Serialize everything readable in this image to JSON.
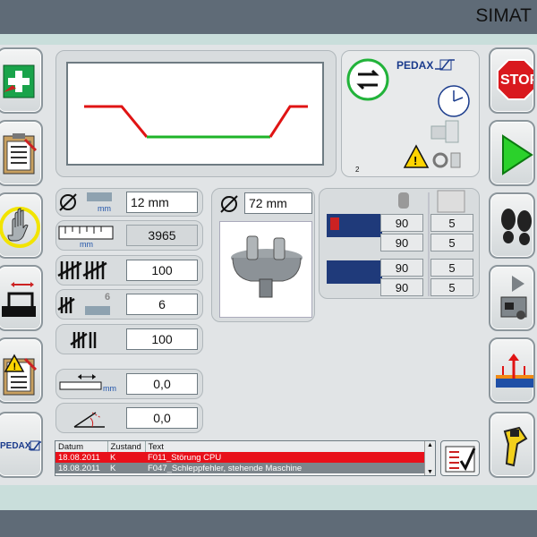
{
  "header": {
    "brand": "SIMAT"
  },
  "left_buttons": [
    {
      "name": "first-aid-button",
      "icon": "first-aid-icon"
    },
    {
      "name": "clipboard-button",
      "icon": "clipboard-icon"
    },
    {
      "name": "manual-hand-button",
      "icon": "hand-icon"
    },
    {
      "name": "bend-setup-button",
      "icon": "bend-machine-icon"
    },
    {
      "name": "warning-checklist-button",
      "icon": "warning-checklist-icon"
    },
    {
      "name": "pedax-logo-button",
      "icon": "pedax-logo-icon"
    }
  ],
  "right_buttons": [
    {
      "name": "stop-button",
      "label": "STOP",
      "icon": "stop-sign-icon"
    },
    {
      "name": "play-button",
      "icon": "play-icon"
    },
    {
      "name": "footsteps-button",
      "icon": "footprints-icon"
    },
    {
      "name": "machine-play-button",
      "icon": "machine-play-icon"
    },
    {
      "name": "lift-button",
      "icon": "lift-arrows-icon"
    },
    {
      "name": "scanner-button",
      "icon": "barcode-scanner-icon"
    }
  ],
  "status_panel": {
    "logo": "PEDAX",
    "number": "2",
    "colors": {
      "cycle_ring": "#22b33a",
      "warning": "#ffd400"
    }
  },
  "profile_chart": {
    "colors": {
      "red": "#e01414",
      "green": "#1eb428"
    }
  },
  "params": {
    "diameter": {
      "value": "12 mm",
      "unit": "mm"
    },
    "length": {
      "value": "3965",
      "unit": "mm"
    },
    "quantity_total": {
      "value": "100"
    },
    "quantity_batch": {
      "value": "6",
      "batch_label": "6"
    },
    "quantity_done": {
      "value": "100"
    },
    "offset": {
      "value": "0,0",
      "unit": "mm"
    },
    "angle": {
      "value": "0,0"
    }
  },
  "tool": {
    "diameter": "72 mm"
  },
  "grid": {
    "rows": [
      [
        "90",
        "5"
      ],
      [
        "90",
        "5"
      ],
      [
        "90",
        "5"
      ],
      [
        "90",
        "5"
      ]
    ]
  },
  "log": {
    "columns": [
      "Datum",
      "Zustand",
      "Text"
    ],
    "rows": [
      {
        "date": "18.08.2011",
        "state": "K",
        "text": "F011_Störung CPU"
      },
      {
        "date": "18.08.2011",
        "state": "K",
        "text": "F047_Schleppfehler, stehende Maschine"
      }
    ]
  }
}
